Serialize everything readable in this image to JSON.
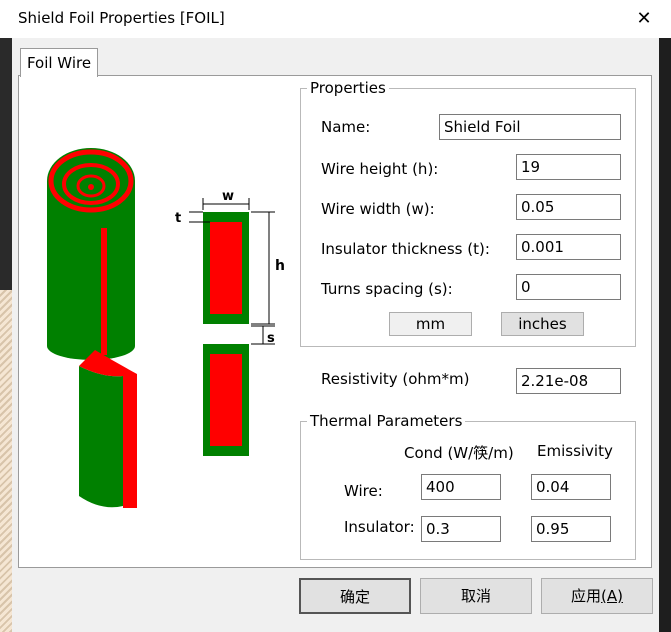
{
  "window": {
    "title": "Shield Foil Properties [FOIL]"
  },
  "tabs": [
    {
      "label": "Foil Wire"
    }
  ],
  "properties": {
    "legend": "Properties",
    "name_label": "Name:",
    "name_value": "Shield Foil",
    "height_label": "Wire height (h):",
    "height_value": "19",
    "width_label": "Wire width (w):",
    "width_value": "0.05",
    "insulator_label": "Insulator thickness (t):",
    "insulator_value": "0.001",
    "spacing_label": "Turns spacing (s):",
    "spacing_value": "0",
    "unit_mm": "mm",
    "unit_inches": "inches"
  },
  "resistivity": {
    "label": "Resistivity (ohm*m)",
    "value": "2.21e-08"
  },
  "thermal": {
    "legend": "Thermal Parameters",
    "col_cond": "Cond (W/筷/m)",
    "col_emissivity": "Emissivity",
    "wire_label": "Wire:",
    "wire_cond": "400",
    "wire_emissivity": "0.04",
    "insulator_label": "Insulator:",
    "insulator_cond": "0.3",
    "insulator_emissivity": "0.95"
  },
  "diagram": {
    "label_w": "w",
    "label_t": "t",
    "label_h": "h",
    "label_s": "s"
  },
  "footer": {
    "ok": "确定",
    "cancel": "取消",
    "apply": "应用",
    "apply_key": "(A)"
  },
  "colors": {
    "wire": "#ff0000",
    "insulator": "#008000"
  }
}
